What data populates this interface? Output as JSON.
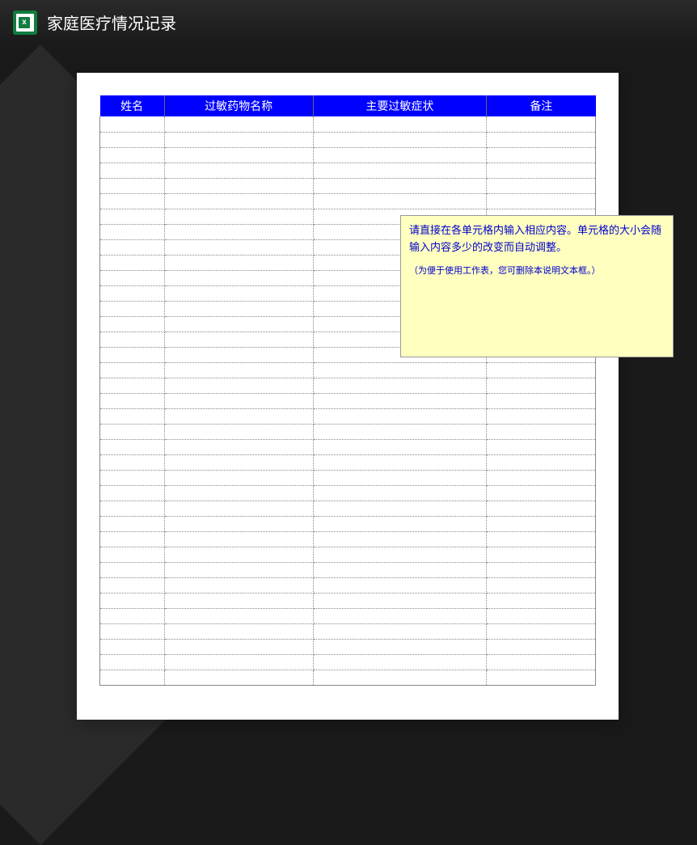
{
  "header": {
    "title": "家庭医疗情况记录",
    "icon_letter": "x"
  },
  "table": {
    "headers": {
      "name": "姓名",
      "drug": "过敏药物名称",
      "symptom": "主要过敏症状",
      "note": "备注"
    },
    "row_count": 37
  },
  "note_box": {
    "line1": "请直接在各单元格内输入相应内容。单元格的大小会随输入内容多少的改变而自动调整。",
    "line2": "（为便于使用工作表，您可删除本说明文本框。）"
  }
}
